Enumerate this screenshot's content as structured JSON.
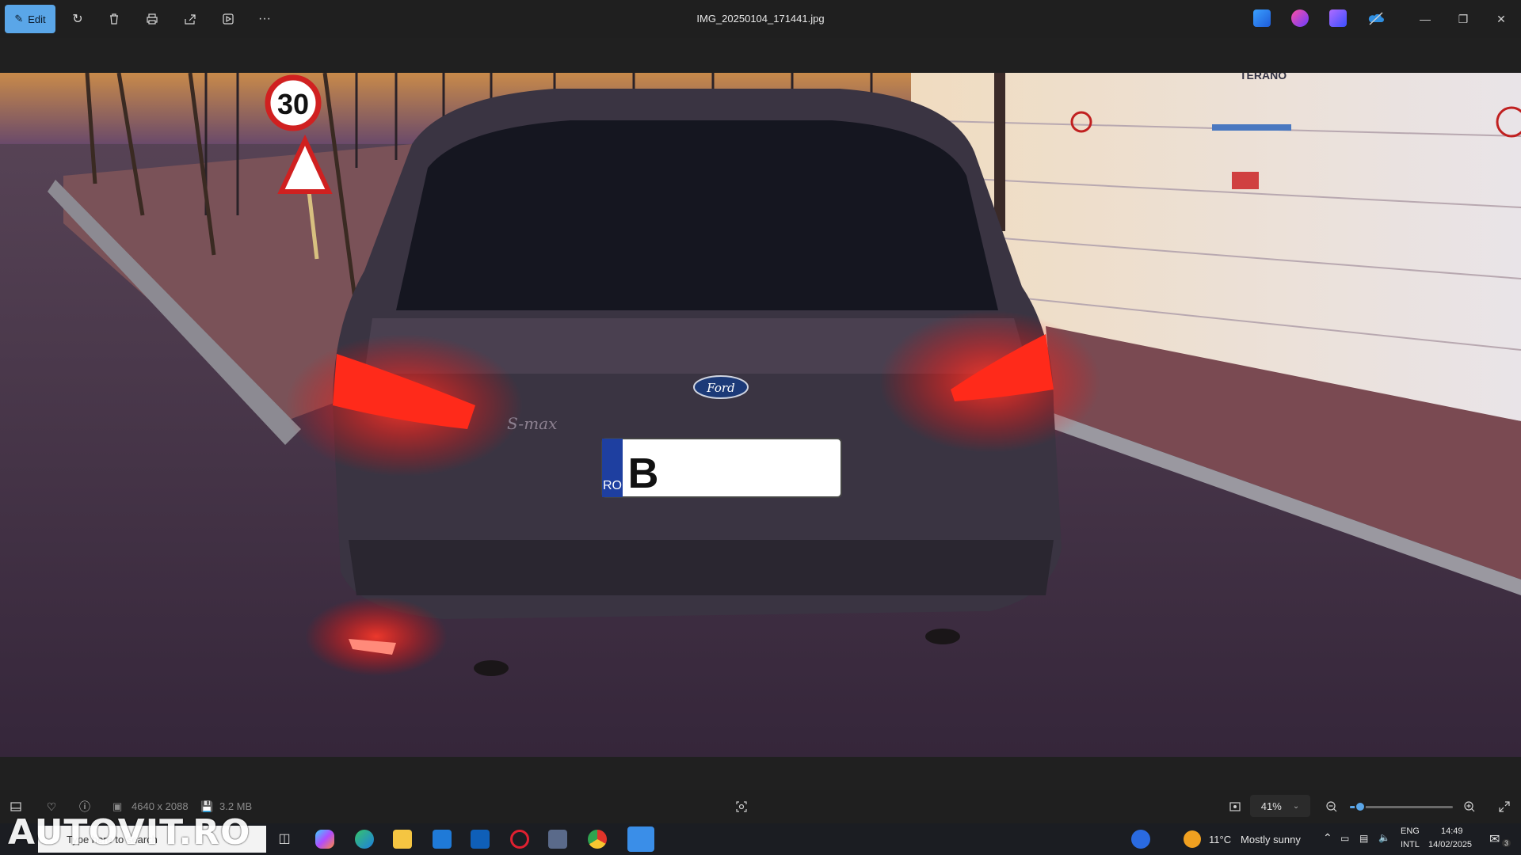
{
  "titlebar": {
    "edit_label": "Edit",
    "file_name": "IMG_20250104_171441.jpg",
    "more_label": "···",
    "icons": [
      "rotate-icon",
      "delete-icon",
      "print-icon",
      "share-icon",
      "slideshow-icon",
      "more-icon",
      "designer-icon",
      "clipchamp-icon",
      "video-editor-icon",
      "onedrive-icon"
    ]
  },
  "photo": {
    "speed_sign": "30",
    "brand_badge": "Ford",
    "model_script": "S-max",
    "plate_country": "RO",
    "plate_letter": "B",
    "wall_sign": "TERANO"
  },
  "bottombar": {
    "dimensions": "4640 x 2088",
    "file_size": "3.2 MB",
    "zoom": "41%",
    "zoom_fraction": 0.1
  },
  "taskbar": {
    "search_placeholder": "Type here to search",
    "temperature": "11°C",
    "weather": "Mostly sunny",
    "lang_1": "ENG",
    "lang_2": "INTL",
    "time": "14:49",
    "date": "14/02/2025",
    "notification_count": "3"
  },
  "watermark": "AUTOVIT.RO",
  "colors": {
    "accent": "#5aa6e8",
    "taillight": "#ff1e1e",
    "car_body": "#3a3442"
  }
}
